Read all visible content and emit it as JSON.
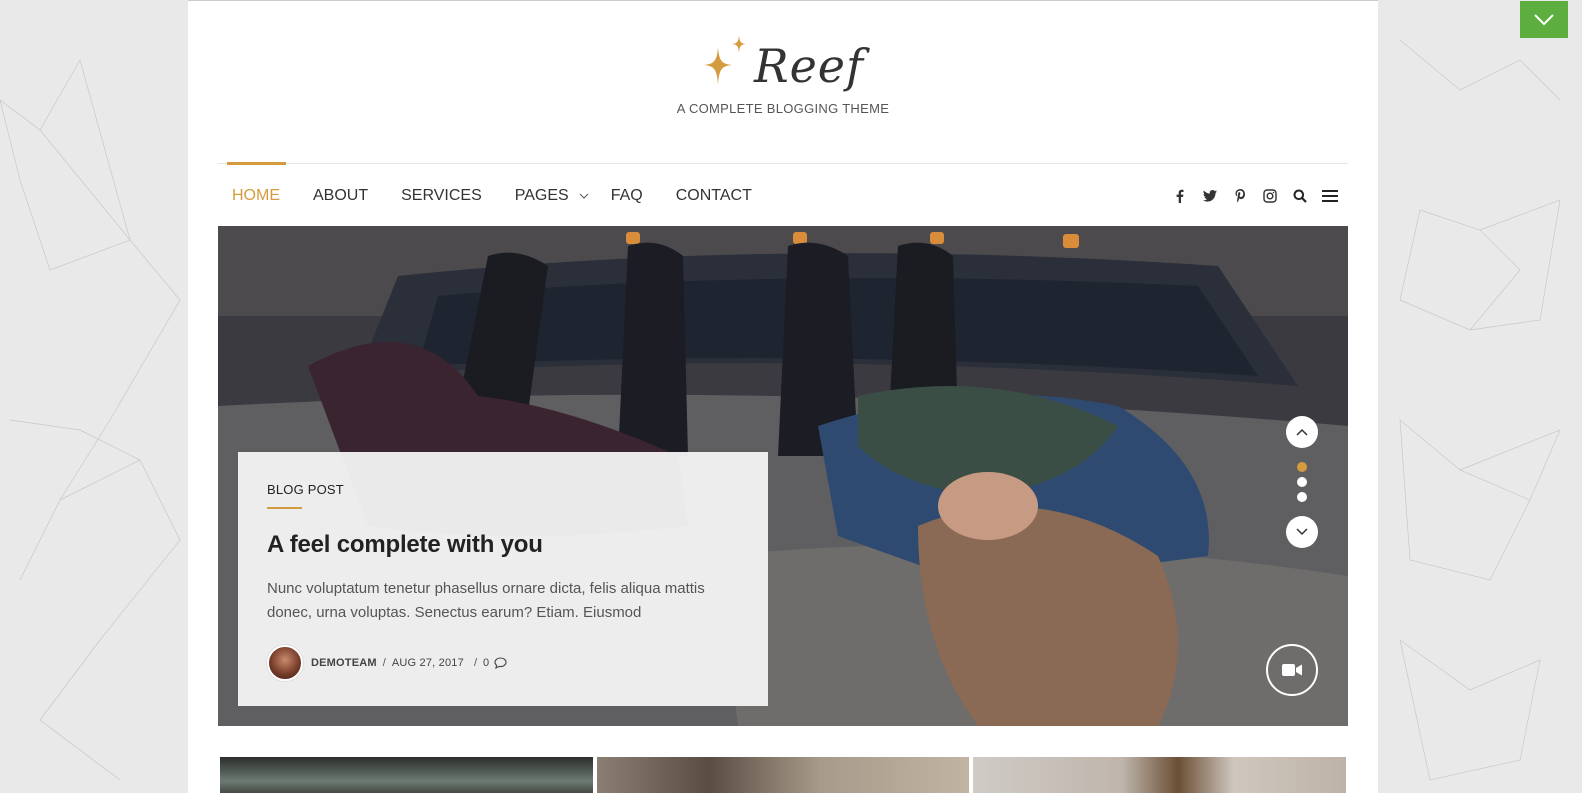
{
  "site": {
    "name": "Reef",
    "tagline": "A COMPLETE BLOGGING THEME",
    "accent": "#d59c3f",
    "toggle_color": "#5cae3f"
  },
  "nav": {
    "items": [
      {
        "label": "HOME",
        "active": true
      },
      {
        "label": "ABOUT"
      },
      {
        "label": "SERVICES"
      },
      {
        "label": "PAGES",
        "has_submenu": true
      },
      {
        "label": "FAQ"
      },
      {
        "label": "CONTACT"
      }
    ],
    "icons": [
      "facebook-icon",
      "twitter-icon",
      "pinterest-icon",
      "instagram-icon",
      "search-icon",
      "menu-icon"
    ]
  },
  "hero": {
    "category": "BLOG POST",
    "title": "A feel complete with you",
    "excerpt": "Nunc voluptatum tenetur phasellus ornare dicta, felis aliqua mattis donec, urna voluptas. Senectus earum? Etiam. Eiusmod",
    "author": "DEMOTEAM",
    "date": "AUG 27, 2017",
    "comments": "0",
    "slides_total": 3,
    "active_slide": 1
  }
}
